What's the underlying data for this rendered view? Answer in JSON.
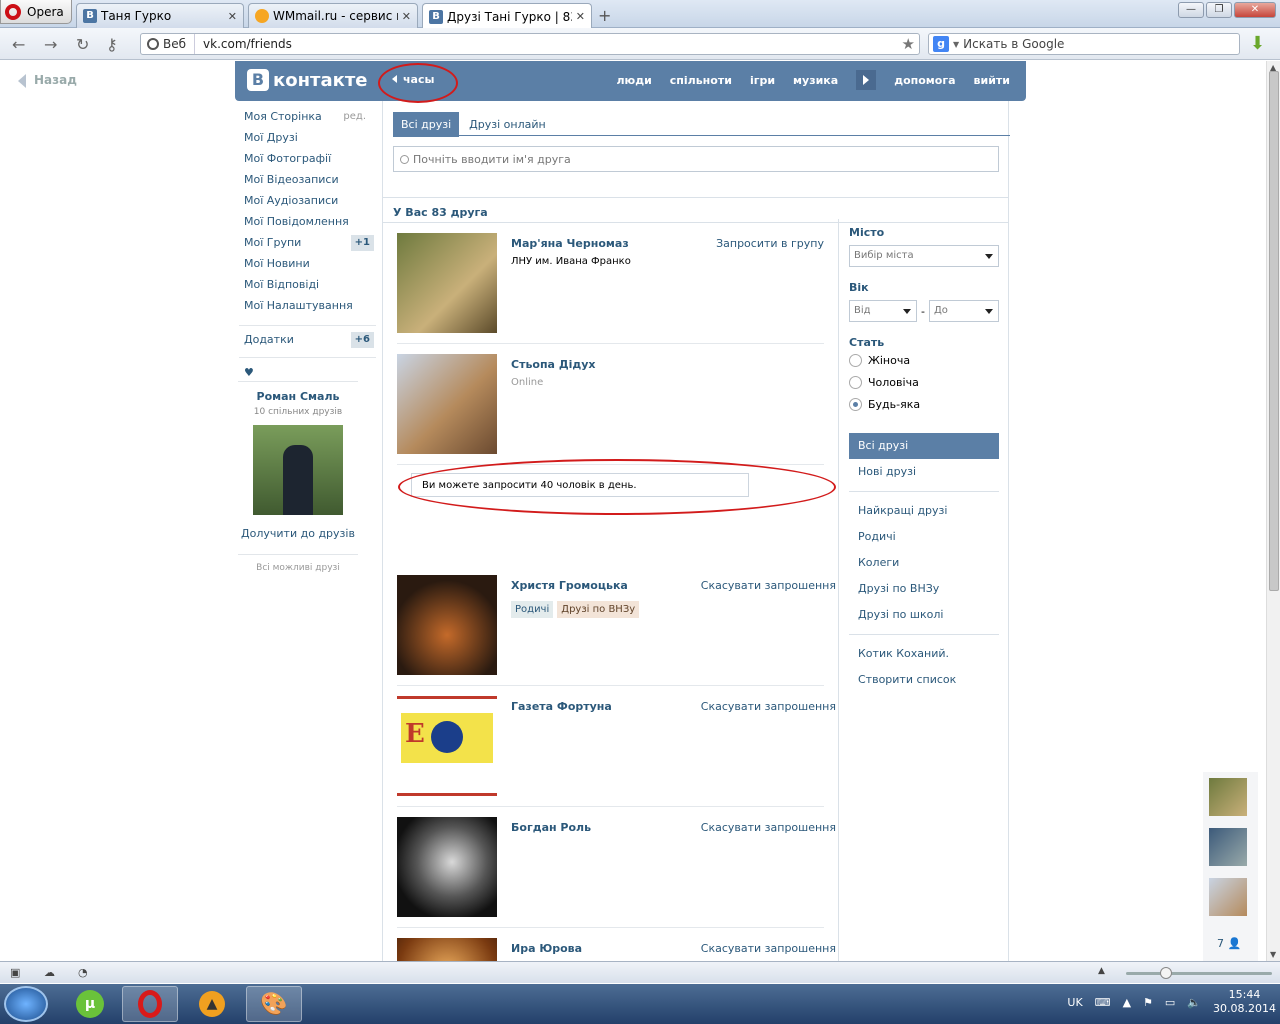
{
  "browser": {
    "menu_label": "Opera",
    "tabs": [
      {
        "title": "Таня Гурко"
      },
      {
        "title": "WMmail.ru - сервис п..."
      },
      {
        "title": "Друзі Тані Гурко | 83 д..."
      }
    ],
    "address": {
      "scheme_label": "Веб",
      "url": "vk.com/friends"
    },
    "search_placeholder": "Искать в Google"
  },
  "page": {
    "back_label": "Назад",
    "header": {
      "logo_text": "контакте",
      "logo_letter": "B",
      "hours_label": "часы",
      "nav": [
        "люди",
        "спільноти",
        "ігри",
        "музика",
        "допомога",
        "вийти"
      ]
    },
    "left_menu": {
      "items": [
        {
          "label": "Моя Сторінка",
          "extra": "ред."
        },
        {
          "label": "Мої Друзі"
        },
        {
          "label": "Мої Фотографії"
        },
        {
          "label": "Мої Відеозаписи"
        },
        {
          "label": "Мої Аудіозаписи"
        },
        {
          "label": "Мої Повідомлення"
        },
        {
          "label": "Мої Групи",
          "badge": "+1"
        },
        {
          "label": "Мої Новини"
        },
        {
          "label": "Мої Відповіді"
        },
        {
          "label": "Мої Налаштування"
        }
      ],
      "apps": {
        "label": "Додатки",
        "badge": "+6"
      },
      "heart": "♥"
    },
    "suggest": {
      "name": "Роман Смаль",
      "mutual": "10 спільних друзів",
      "add": "Долучити до друзів",
      "all": "Всі можливі друзі"
    },
    "tabs": [
      "Всі друзі",
      "Друзі онлайн"
    ],
    "search_placeholder": "Почніть вводити ім'я друга",
    "count_label": "У Вас 83 друга",
    "friends": [
      {
        "name": "Мар'яна Черномаз",
        "sub": "ЛНУ им. Ивана Франко",
        "action": "Запросити в групу"
      },
      {
        "name": "Стьопа Дідух",
        "sub": "Online",
        "action": ""
      },
      {
        "name": "Христя Громоцька",
        "tags": [
          "Родичі",
          "Друзі по ВНЗу"
        ],
        "action": "Скасувати запрошення"
      },
      {
        "name": "Газета Фортуна",
        "action": "Скасувати запрошення"
      },
      {
        "name": "Богдан Роль",
        "action": "Скасувати запрошення"
      },
      {
        "name": "Ира Юрова",
        "action": "Скасувати запрошення"
      }
    ],
    "notice": "Ви можете запросити 40 чоловік в день.",
    "filters": {
      "city_label": "Місто",
      "city_select": "Вибір міста",
      "age_label": "Вік",
      "age_from": "Від",
      "age_dash": "-",
      "age_to": "До",
      "sex_label": "Стать",
      "sex_options": [
        "Жіноча",
        "Чоловіча",
        "Будь-яка"
      ],
      "lists": [
        "Всі друзі",
        "Нові друзі",
        "Найкращі друзі",
        "Родичі",
        "Колеги",
        "Друзі по ВНЗу",
        "Друзі по школі",
        "Котик Коханий.",
        "Створити список"
      ]
    },
    "chat_count": "7"
  },
  "taskbar": {
    "lang": "UK",
    "time": "15:44",
    "date": "30.08.2014"
  },
  "colors": {
    "vk_blue": "#5b7fa6",
    "link": "#2b587a",
    "annotation_red": "#d21b1b"
  }
}
